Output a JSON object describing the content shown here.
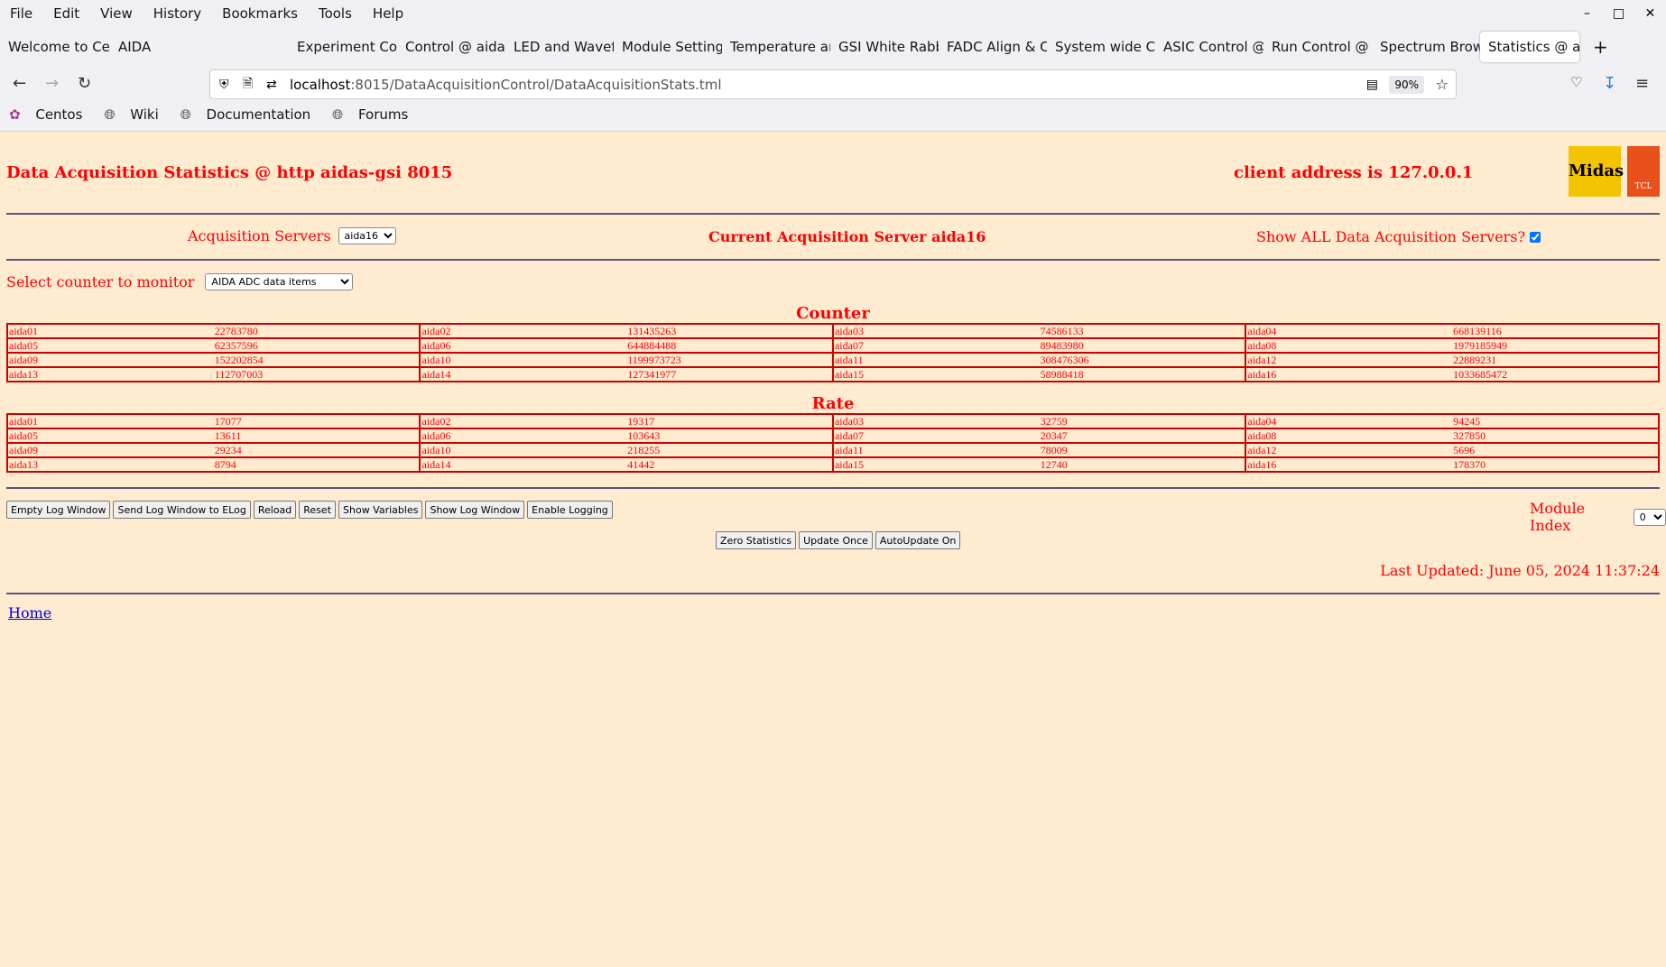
{
  "browser": {
    "menu": [
      "File",
      "Edit",
      "View",
      "History",
      "Bookmarks",
      "Tools",
      "Help"
    ],
    "tabs": [
      "Welcome to Cen",
      "AIDA",
      "Experiment Cont",
      "Control @ aidas",
      "LED and Wavefo",
      "Module Settings",
      "Temperature and",
      "GSI White Rabbi",
      "FADC Align & Co",
      "System wide Ch",
      "ASIC Control @",
      "Run Control @ a",
      "Spectrum Brows",
      "Statistics @ ai"
    ],
    "url_host": "localhost",
    "url_rest": ":8015/DataAcquisitionControl/DataAcquisitionStats.tml",
    "zoom": "90%",
    "bookmarks": [
      "Centos",
      "Wiki",
      "Documentation",
      "Forums"
    ]
  },
  "header": {
    "title": "Data Acquisition Statistics @ http aidas-gsi 8015",
    "client": "client address is 127.0.0.1",
    "logo_text": "Midas",
    "logo2_text": "TCL"
  },
  "servers": {
    "label": "Acquisition Servers",
    "selected": "aida16",
    "current": "Current Acquisition Server aida16",
    "show_all_label": "Show ALL Data Acquisition Servers?",
    "show_all_checked": true
  },
  "counter_select": {
    "label": "Select counter to monitor",
    "selected": "AIDA ADC data items"
  },
  "counter": {
    "heading": "Counter",
    "rows": [
      [
        [
          "aida01",
          "22783780"
        ],
        [
          "aida02",
          "131435263"
        ],
        [
          "aida03",
          "74586133"
        ],
        [
          "aida04",
          "668139116"
        ]
      ],
      [
        [
          "aida05",
          "62357596"
        ],
        [
          "aida06",
          "644884488"
        ],
        [
          "aida07",
          "89483980"
        ],
        [
          "aida08",
          "1979185949"
        ]
      ],
      [
        [
          "aida09",
          "152202854"
        ],
        [
          "aida10",
          "1199973723"
        ],
        [
          "aida11",
          "308476306"
        ],
        [
          "aida12",
          "22889231"
        ]
      ],
      [
        [
          "aida13",
          "112707003"
        ],
        [
          "aida14",
          "127341977"
        ],
        [
          "aida15",
          "58988418"
        ],
        [
          "aida16",
          "1033685472"
        ]
      ]
    ]
  },
  "rate": {
    "heading": "Rate",
    "rows": [
      [
        [
          "aida01",
          "17077"
        ],
        [
          "aida02",
          "19317"
        ],
        [
          "aida03",
          "32759"
        ],
        [
          "aida04",
          "94245"
        ]
      ],
      [
        [
          "aida05",
          "13611"
        ],
        [
          "aida06",
          "103643"
        ],
        [
          "aida07",
          "20347"
        ],
        [
          "aida08",
          "327850"
        ]
      ],
      [
        [
          "aida09",
          "29234"
        ],
        [
          "aida10",
          "218255"
        ],
        [
          "aida11",
          "78009"
        ],
        [
          "aida12",
          "5696"
        ]
      ],
      [
        [
          "aida13",
          "8794"
        ],
        [
          "aida14",
          "41442"
        ],
        [
          "aida15",
          "12740"
        ],
        [
          "aida16",
          "178370"
        ]
      ]
    ]
  },
  "buttons": [
    "Empty Log Window",
    "Send Log Window to ELog",
    "Reload",
    "Reset",
    "Show Variables",
    "Show Log Window",
    "Enable Logging"
  ],
  "module_index": {
    "label": "Module Index",
    "selected": "0"
  },
  "buttons2": [
    "Zero Statistics",
    "Update Once",
    "AutoUpdate On"
  ],
  "last_updated": "Last Updated: June 05, 2024 11:37:24",
  "home_link": "Home"
}
